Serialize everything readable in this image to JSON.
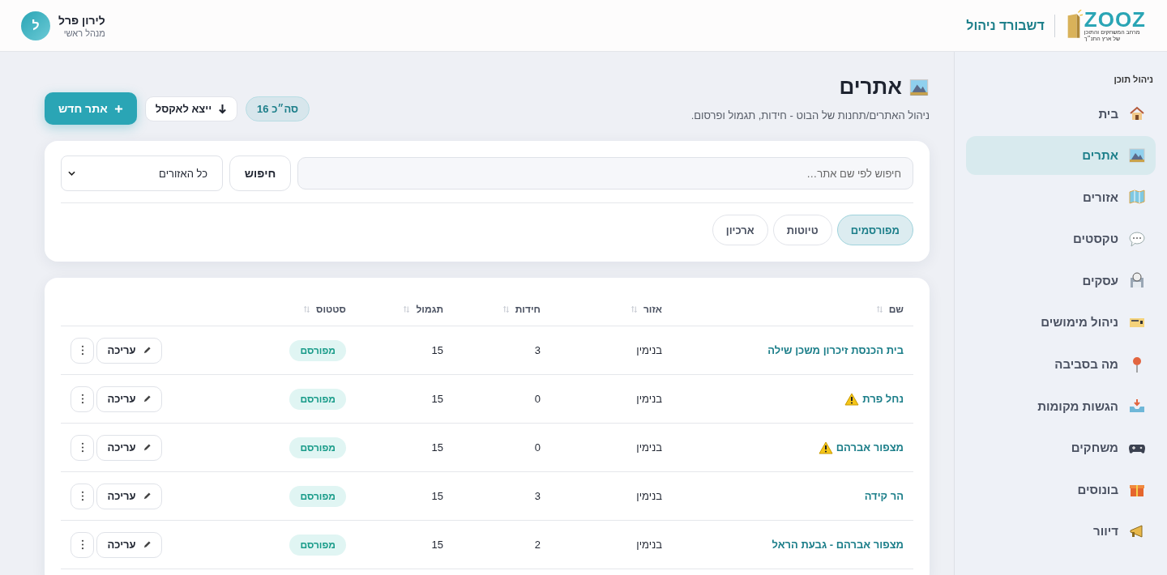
{
  "header": {
    "user": {
      "initial": "ל",
      "name": "לירון פרל",
      "role": "מנהל ראשי"
    },
    "title": "דשבורד ניהול",
    "logo": {
      "text": "ZOOZ",
      "tagline": [
        "מרחב המשחקים והתוכן",
        "של ארץ התנ״ך"
      ]
    }
  },
  "sidebar": {
    "section": "ניהול תוכן",
    "items": [
      {
        "label": "בית",
        "selected": false
      },
      {
        "label": "אתרים",
        "selected": true
      },
      {
        "label": "אזורים",
        "selected": false
      },
      {
        "label": "טקסטים",
        "selected": false
      },
      {
        "label": "עסקים",
        "selected": false
      },
      {
        "label": "ניהול מימושים",
        "selected": false
      },
      {
        "label": "מה בסביבה",
        "selected": false
      },
      {
        "label": "הגשות מקומות",
        "selected": false
      },
      {
        "label": "משחקים",
        "selected": false
      },
      {
        "label": "בונוסים",
        "selected": false
      },
      {
        "label": "דיוור",
        "selected": false
      }
    ]
  },
  "page": {
    "title": "אתרים",
    "subtitle": "ניהול האתרים/תחנות של הבוט - חידות, תגמול ופרסום.",
    "total": "סה״כ 16",
    "export_button": "ייצא לאקסל",
    "new_button": "אתר חדש"
  },
  "filters": {
    "search_placeholder": "חיפוש לפי שם אתר…",
    "search_button": "חיפוש",
    "region_select": "כל האזורים",
    "tabs": [
      {
        "label": "מפורסמים",
        "selected": true
      },
      {
        "label": "טיוטות",
        "selected": false
      },
      {
        "label": "ארכיון",
        "selected": false
      }
    ]
  },
  "table": {
    "columns": [
      "שם",
      "אזור",
      "חידות",
      "תגמול",
      "סטטוס"
    ],
    "rows": [
      {
        "name": "בית הכנסת זיכרון משכן שילה",
        "warning": false,
        "region": "בנימין",
        "riddles": "3",
        "reward": "15",
        "status": "מפורסם",
        "edit": "עריכה"
      },
      {
        "name": "נחל פרת",
        "warning": true,
        "region": "בנימין",
        "riddles": "0",
        "reward": "15",
        "status": "מפורסם",
        "edit": "עריכה"
      },
      {
        "name": "מצפור אברהם",
        "warning": true,
        "region": "בנימין",
        "riddles": "0",
        "reward": "15",
        "status": "מפורסם",
        "edit": "עריכה"
      },
      {
        "name": "הר קידה",
        "warning": false,
        "region": "בנימין",
        "riddles": "3",
        "reward": "15",
        "status": "מפורסם",
        "edit": "עריכה"
      },
      {
        "name": "מצפור אברהם - גבעת הראל",
        "warning": false,
        "region": "בנימין",
        "riddles": "2",
        "reward": "15",
        "status": "מפורסם",
        "edit": "עריכה"
      }
    ]
  }
}
